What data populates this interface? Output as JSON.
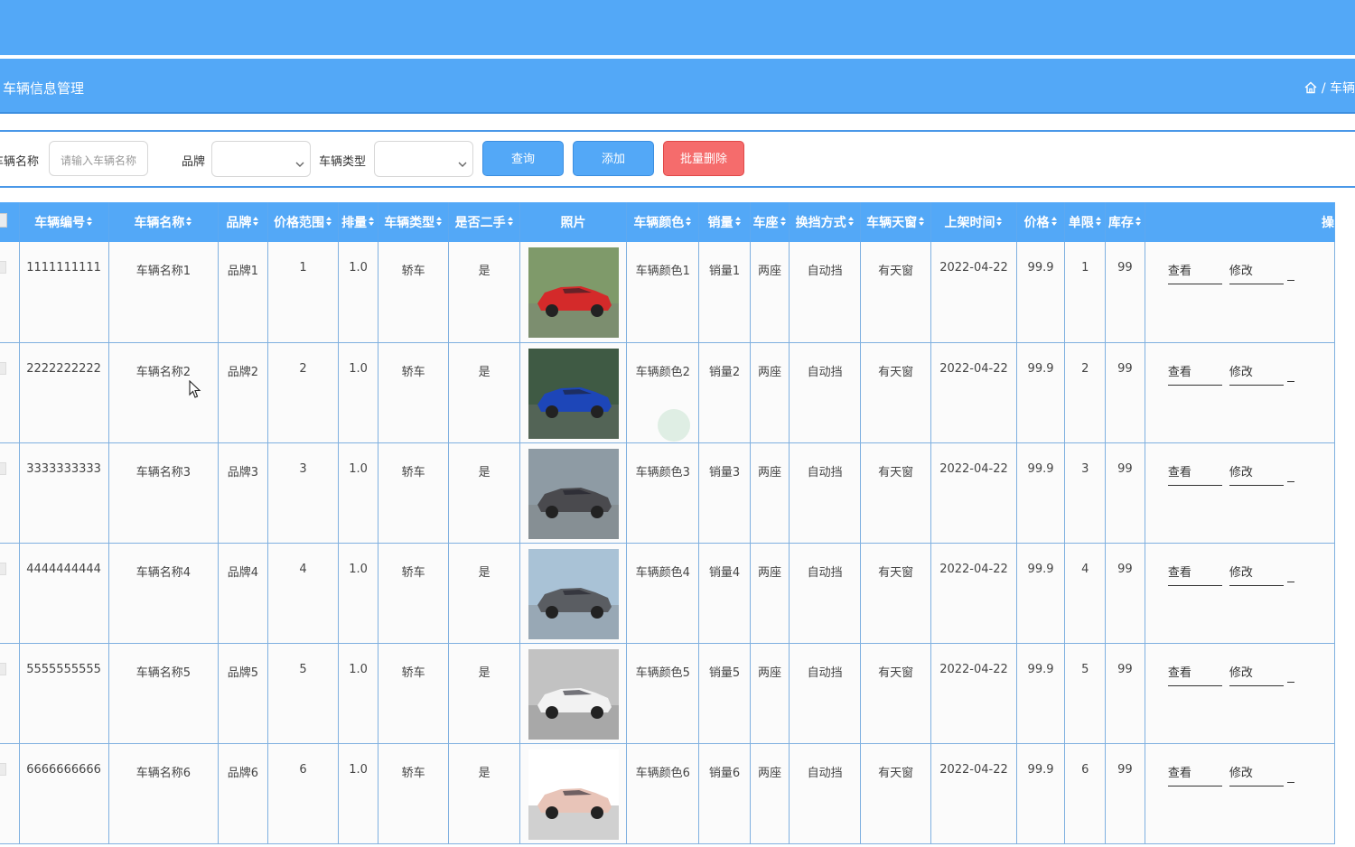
{
  "header": {
    "page_title": "车辆信息管理",
    "breadcrumb_separator": "/",
    "breadcrumb_current": "车辆"
  },
  "search": {
    "name_label": "车辆名称",
    "name_placeholder": "请输入车辆名称",
    "brand_label": "品牌",
    "brand_value": "",
    "type_label": "车辆类型",
    "type_value": "",
    "query_button": "查询",
    "add_button": "添加",
    "batch_delete_button": "批量删除"
  },
  "table": {
    "columns": [
      "车辆编号",
      "车辆名称",
      "品牌",
      "价格范围",
      "排量",
      "车辆类型",
      "是否二手",
      "照片",
      "车辆颜色",
      "销量",
      "车座",
      "换挡方式",
      "车辆天窗",
      "上架时间",
      "价格",
      "单限",
      "库存",
      "操"
    ],
    "actions": {
      "view": "查看",
      "edit": "修改"
    },
    "rows": [
      {
        "code": "1111111111",
        "name": "车辆名称1",
        "brand": "品牌1",
        "price_range": "1",
        "displacement": "1.0",
        "type": "轿车",
        "used": "是",
        "color": "车辆颜色1",
        "sales": "销量1",
        "seats": "两座",
        "gearbox": "自动挡",
        "sunroof": "有天窗",
        "date": "2022-04-22",
        "price": "99.9",
        "limit": "1",
        "stock": "99"
      },
      {
        "code": "2222222222",
        "name": "车辆名称2",
        "brand": "品牌2",
        "price_range": "2",
        "displacement": "1.0",
        "type": "轿车",
        "used": "是",
        "color": "车辆颜色2",
        "sales": "销量2",
        "seats": "两座",
        "gearbox": "自动挡",
        "sunroof": "有天窗",
        "date": "2022-04-22",
        "price": "99.9",
        "limit": "2",
        "stock": "99"
      },
      {
        "code": "3333333333",
        "name": "车辆名称3",
        "brand": "品牌3",
        "price_range": "3",
        "displacement": "1.0",
        "type": "轿车",
        "used": "是",
        "color": "车辆颜色3",
        "sales": "销量3",
        "seats": "两座",
        "gearbox": "自动挡",
        "sunroof": "有天窗",
        "date": "2022-04-22",
        "price": "99.9",
        "limit": "3",
        "stock": "99"
      },
      {
        "code": "4444444444",
        "name": "车辆名称4",
        "brand": "品牌4",
        "price_range": "4",
        "displacement": "1.0",
        "type": "轿车",
        "used": "是",
        "color": "车辆颜色4",
        "sales": "销量4",
        "seats": "两座",
        "gearbox": "自动挡",
        "sunroof": "有天窗",
        "date": "2022-04-22",
        "price": "99.9",
        "limit": "4",
        "stock": "99"
      },
      {
        "code": "5555555555",
        "name": "车辆名称5",
        "brand": "品牌5",
        "price_range": "5",
        "displacement": "1.0",
        "type": "轿车",
        "used": "是",
        "color": "车辆颜色5",
        "sales": "销量5",
        "seats": "两座",
        "gearbox": "自动挡",
        "sunroof": "有天窗",
        "date": "2022-04-22",
        "price": "99.9",
        "limit": "5",
        "stock": "99"
      },
      {
        "code": "6666666666",
        "name": "车辆名称6",
        "brand": "品牌6",
        "price_range": "6",
        "displacement": "1.0",
        "type": "轿车",
        "used": "是",
        "color": "车辆颜色6",
        "sales": "销量6",
        "seats": "两座",
        "gearbox": "自动挡",
        "sunroof": "有天窗",
        "date": "2022-04-22",
        "price": "99.9",
        "limit": "6",
        "stock": "99"
      }
    ],
    "photo_colors": [
      "#d42a2a",
      "#1d46b8",
      "#4a4a4e",
      "#5a5d62",
      "#f2f2f2",
      "#e8c4b8"
    ],
    "photo_backgrounds": [
      "#7f9a6a",
      "#3f5a44",
      "#8e9ba4",
      "#a9c2d6",
      "#c2c2c2",
      "#ffffff"
    ]
  },
  "colors": {
    "primary": "#53a8f7",
    "danger": "#f56c6c"
  }
}
